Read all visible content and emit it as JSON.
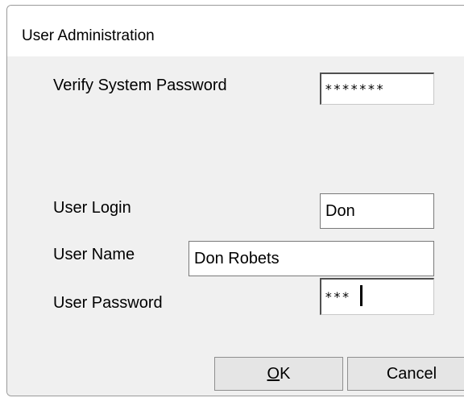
{
  "window": {
    "title": "User Administration"
  },
  "form": {
    "verify_system_password": {
      "label": "Verify System Password",
      "value": "*******"
    },
    "user_login": {
      "label": "User Login",
      "value": "Don"
    },
    "user_name": {
      "label": "User Name",
      "value": "Don Robets"
    },
    "user_password": {
      "label": "User Password",
      "value": "***"
    }
  },
  "buttons": {
    "ok": {
      "mnemonic": "O",
      "rest": "K"
    },
    "cancel": {
      "label": "Cancel"
    }
  },
  "colors": {
    "dialog_bg": "#f0f0f0",
    "title_bg": "#ffffff",
    "border": "#9a9a9a"
  }
}
